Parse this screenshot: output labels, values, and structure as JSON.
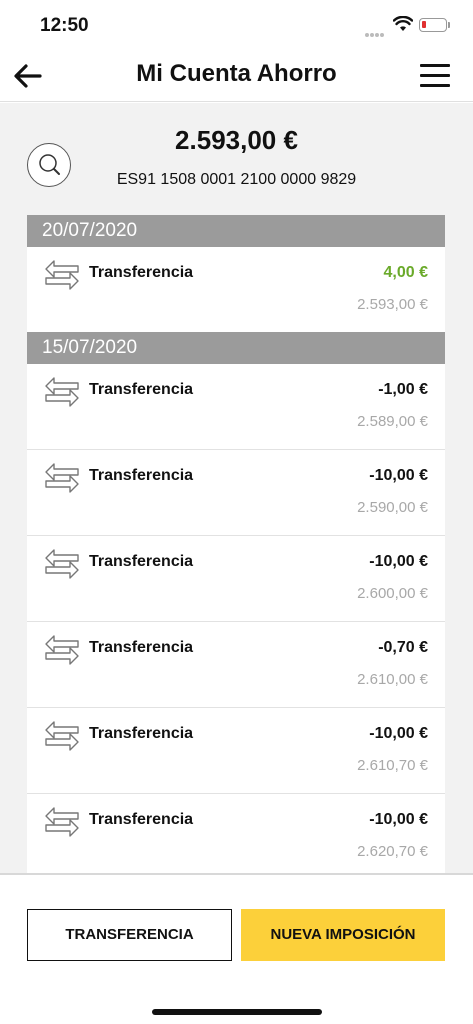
{
  "status_bar": {
    "time": "12:50"
  },
  "header": {
    "title": "Mi Cuenta Ahorro"
  },
  "account": {
    "balance": "2.593,00 €",
    "iban": "ES91 1508 0001 2100 0000 9829"
  },
  "groups": [
    {
      "date": "20/07/2020",
      "movements": [
        {
          "label": "Transferencia",
          "amount": "4,00 €",
          "balance": "2.593,00 €",
          "positive": true
        }
      ]
    },
    {
      "date": "15/07/2020",
      "movements": [
        {
          "label": "Transferencia",
          "amount": "-1,00 €",
          "balance": "2.589,00 €"
        },
        {
          "label": "Transferencia",
          "amount": "-10,00 €",
          "balance": "2.590,00 €"
        },
        {
          "label": "Transferencia",
          "amount": "-10,00 €",
          "balance": "2.600,00 €"
        },
        {
          "label": "Transferencia",
          "amount": "-0,70 €",
          "balance": "2.610,00 €"
        },
        {
          "label": "Transferencia",
          "amount": "-10,00 €",
          "balance": "2.610,70 €"
        },
        {
          "label": "Transferencia",
          "amount": "-10,00 €",
          "balance": "2.620,70 €"
        }
      ]
    }
  ],
  "actions": {
    "transfer_label": "TRANSFERENCIA",
    "new_deposit_label": "NUEVA IMPOSICIÓN"
  },
  "colors": {
    "accent": "#fcd03a",
    "positive": "#6aaa2a",
    "date_header": "#9b9b9b"
  },
  "icons": [
    "back-arrow-icon",
    "hamburger-menu-icon",
    "search-icon",
    "transfer-arrows-icon",
    "wifi-icon",
    "battery-icon"
  ]
}
